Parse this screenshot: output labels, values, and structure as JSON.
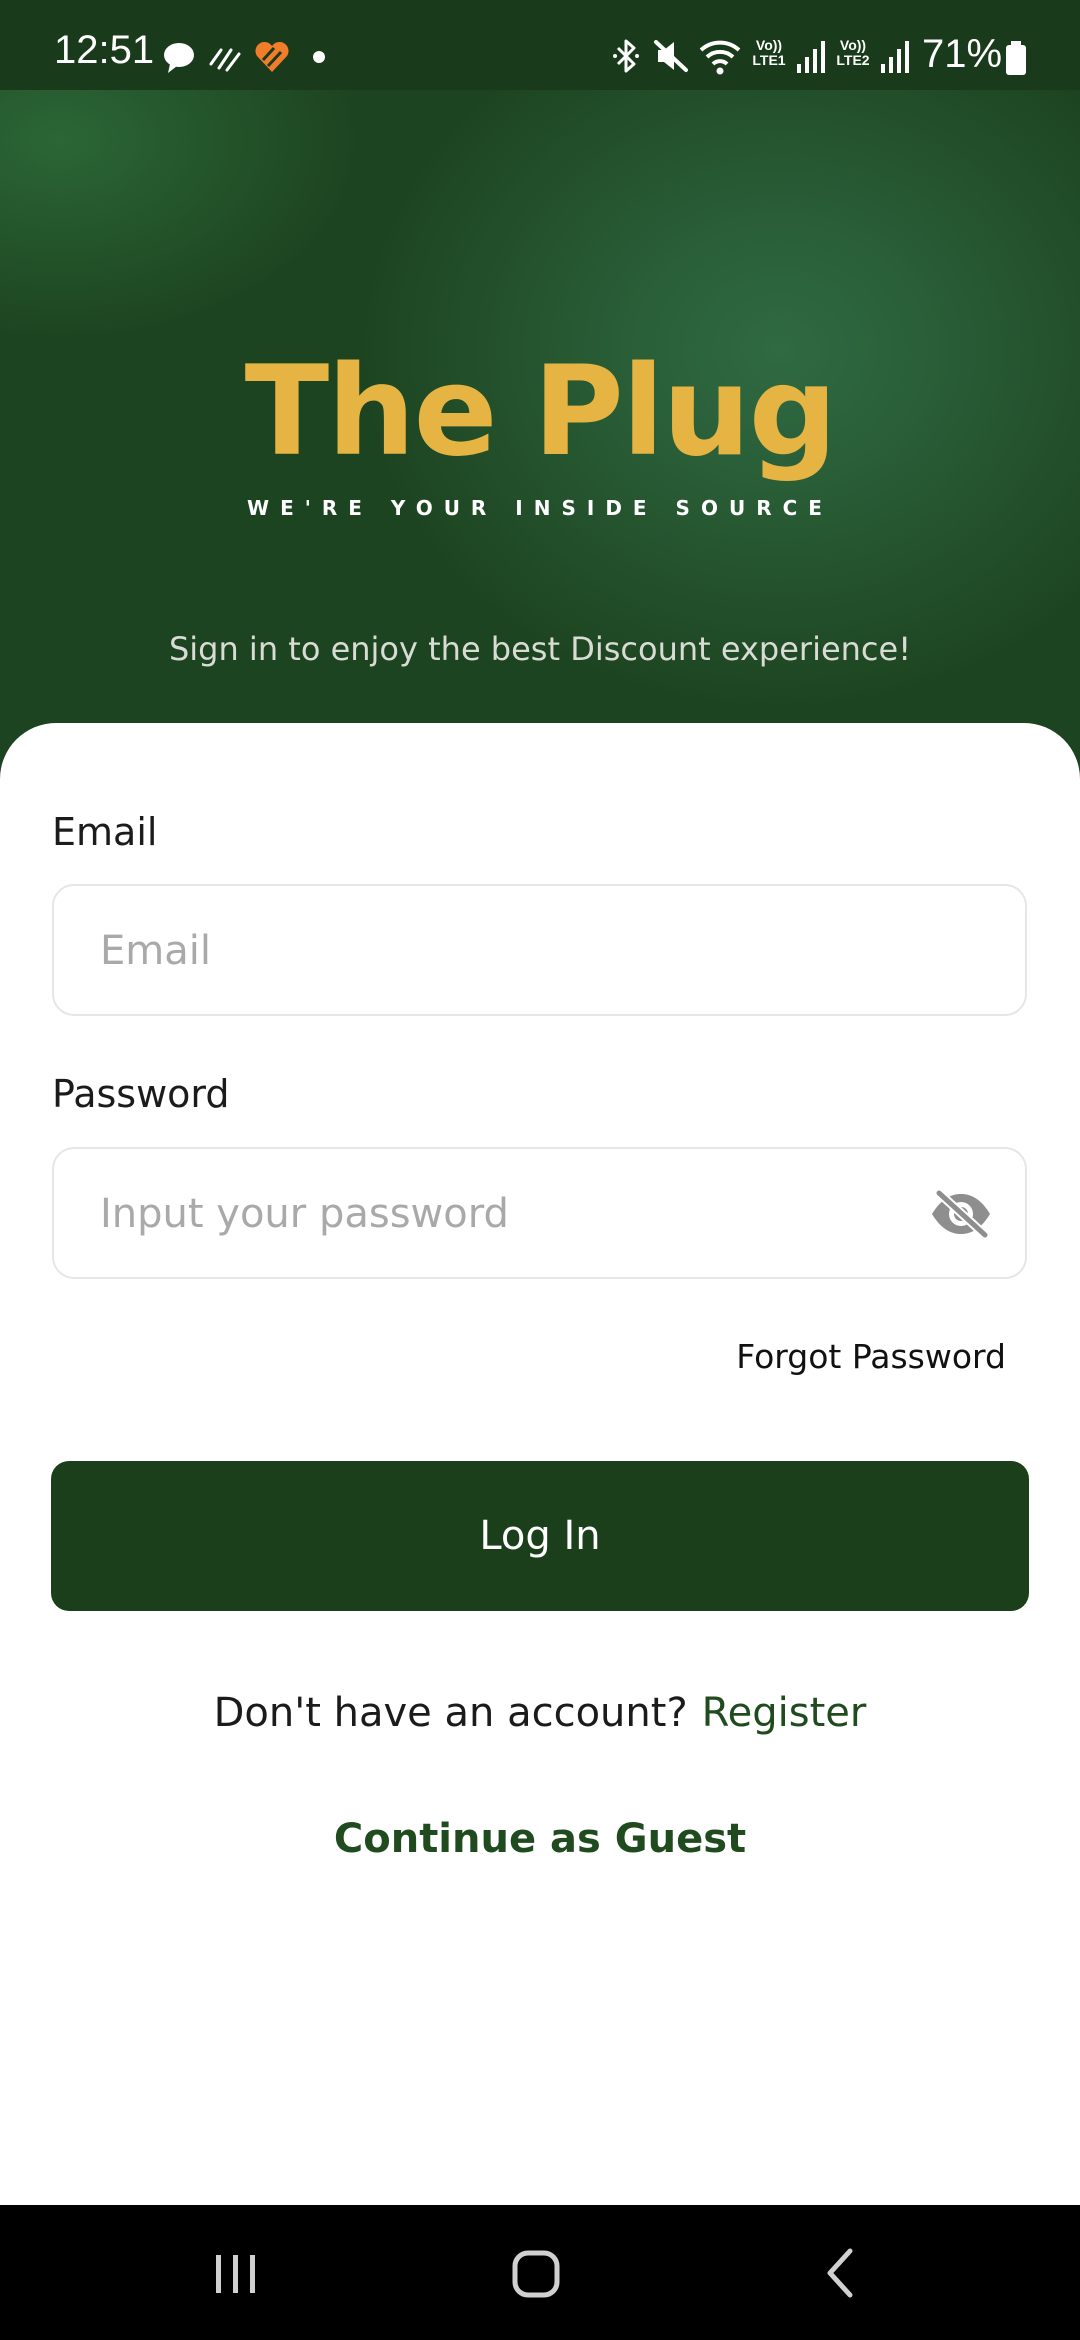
{
  "status_bar": {
    "time": "12:51",
    "battery": "71%",
    "sim1_label": "Vo)) LTE1",
    "sim2_label": "Vo)) LTE2",
    "icons": [
      "chat-icon",
      "slash-icon",
      "heart-app-icon",
      "dot-icon",
      "bluetooth-icon",
      "mute-icon",
      "wifi-icon",
      "signal-icon",
      "signal-icon",
      "battery-icon"
    ]
  },
  "hero": {
    "logo_word1": "The",
    "logo_word2": "Plug",
    "tagline": "WE'RE YOUR INSIDE SOURCE",
    "subtitle": "Sign in to enjoy the best Discount experience!"
  },
  "form": {
    "email_label": "Email",
    "email_placeholder": "Email",
    "email_value": "",
    "password_label": "Password",
    "password_placeholder": "Input your password",
    "password_value": "",
    "forgot_label": "Forgot Password",
    "login_label": "Log In",
    "no_account_text": "Don't have an account?",
    "register_label": "Register",
    "guest_label": "Continue as Guest"
  },
  "nav_bar": {
    "buttons": [
      "recents-icon",
      "home-icon",
      "back-icon"
    ]
  },
  "colors": {
    "brand_green": "#1b3f1a",
    "logo_gold": "#e5b443",
    "link_green": "#1f4b1f"
  }
}
